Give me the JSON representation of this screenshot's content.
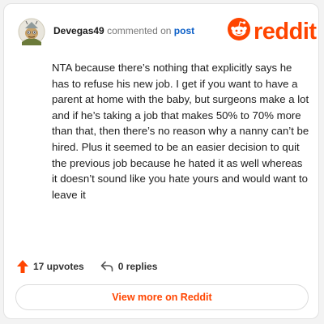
{
  "header": {
    "username": "Devegas49",
    "commented_text": "commented on",
    "post_link": "post",
    "logo_text": "reddit",
    "avatar_icon": "user-avatar-icon"
  },
  "comment": {
    "body": "NTA because there’s nothing that explicitly says he has to refuse his new job. I get if you want to have a parent at home with the baby, but surgeons make a lot and if he’s taking a job that makes 50% to 70% more than that, then there’s no reason why a nanny can’t be hired. Plus it seemed to be an easier decision to quit the previous job because he hated it as well whereas it doesn’t sound like you hate yours and would want to leave it"
  },
  "actions": {
    "upvotes": "17 upvotes",
    "replies": "0 replies",
    "upvote_icon": "upvote-arrow-icon",
    "reply_icon": "reply-arrow-icon"
  },
  "cta": {
    "label": "View more on Reddit"
  },
  "colors": {
    "brand": "#ff4500",
    "link": "#0a5ec7",
    "text": "#1c1c1c",
    "muted": "#777777"
  }
}
